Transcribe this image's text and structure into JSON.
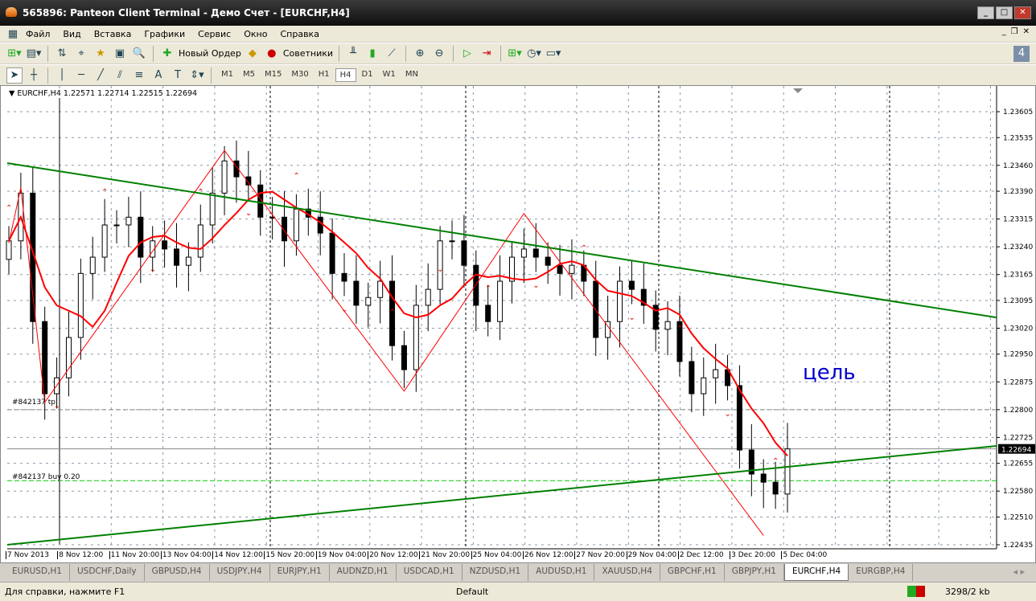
{
  "window": {
    "title": "565896: Panteon Client Terminal - Демо Счет - [EURCHF,H4]"
  },
  "menu": [
    "Файл",
    "Вид",
    "Вставка",
    "Графики",
    "Сервис",
    "Окно",
    "Справка"
  ],
  "toolbar": {
    "new_order": "Новый Ордер",
    "experts": "Советники"
  },
  "timeframes": [
    "M1",
    "M5",
    "M15",
    "M30",
    "H1",
    "H4",
    "D1",
    "W1",
    "MN"
  ],
  "active_timeframe": "H4",
  "chart": {
    "header": "EURCHF,H4  1.22571 1.22714 1.22515 1.22694",
    "current_price": "1.22694",
    "price_labels": [
      "1.23605",
      "1.23535",
      "1.23460",
      "1.23390",
      "1.23315",
      "1.23240",
      "1.23165",
      "1.23095",
      "1.23020",
      "1.22950",
      "1.22875",
      "1.22800",
      "1.22725",
      "1.22655",
      "1.22580",
      "1.22510",
      "1.22435"
    ],
    "time_labels": [
      "7 Nov 2013",
      "8 Nov 12:00",
      "11 Nov 20:00",
      "13 Nov 04:00",
      "14 Nov 12:00",
      "15 Nov 20:00",
      "19 Nov 04:00",
      "20 Nov 12:00",
      "21 Nov 20:00",
      "25 Nov 04:00",
      "26 Nov 12:00",
      "27 Nov 20:00",
      "29 Nov 04:00",
      "2 Dec 12:00",
      "3 Dec 20:00",
      "5 Dec 04:00"
    ],
    "tp_label": "#842137 tp",
    "tp_price": 1.228,
    "buy_label": "#842137 buy 0.20",
    "buy_price": 1.22608,
    "annotation": "цель",
    "closes": [
      1.23256,
      1.23385,
      1.23038,
      1.22843,
      1.22886,
      1.22995,
      1.23168,
      1.23212,
      1.23299,
      1.23299,
      1.2332,
      1.23212,
      1.23256,
      1.23234,
      1.2319,
      1.23212,
      1.23299,
      1.23385,
      1.23472,
      1.23429,
      1.23407,
      1.2332,
      1.2332,
      1.23256,
      1.23342,
      1.2332,
      1.23277,
      1.23168,
      1.23147,
      1.23082,
      1.23103,
      1.23147,
      1.22973,
      1.22908,
      1.23082,
      1.23125,
      1.23256,
      1.23256,
      1.2319,
      1.23082,
      1.23038,
      1.23147,
      1.23212,
      1.23234,
      1.23212,
      1.2319,
      1.23168,
      1.2319,
      1.23147,
      1.22995,
      1.23038,
      1.23147,
      1.23125,
      1.23082,
      1.23017,
      1.23038,
      1.2293,
      1.22843,
      1.22886,
      1.22908,
      1.22865,
      1.22691,
      1.22626,
      1.22604,
      1.22572,
      1.22694
    ],
    "zigzag": [
      [
        0,
        1.2325
      ],
      [
        1,
        1.234
      ],
      [
        3,
        1.2282
      ],
      [
        18,
        1.235
      ],
      [
        33,
        1.2285
      ],
      [
        43,
        1.2333
      ],
      [
        63,
        1.2246
      ]
    ],
    "trendlines": [
      [
        1.23466,
        1.23049
      ],
      [
        1.22435,
        1.22702
      ]
    ],
    "colors": {
      "ma": "#ff0000",
      "trend": "#008000",
      "zigzag": "#ff0000",
      "annotation": "#0000cc"
    }
  },
  "tabs": [
    "EURUSD,H1",
    "USDCHF,Daily",
    "GBPUSD,H4",
    "USDJPY,H4",
    "EURJPY,H1",
    "AUDNZD,H1",
    "USDCAD,H1",
    "NZDUSD,H1",
    "AUDUSD,H1",
    "XAUUSD,H4",
    "GBPCHF,H1",
    "GBPJPY,H1",
    "EURCHF,H4",
    "EURGBP,H4"
  ],
  "active_tab": "EURCHF,H4",
  "status": {
    "help": "Для справки, нажмите F1",
    "profile": "Default",
    "traffic": "3298/2 kb"
  }
}
